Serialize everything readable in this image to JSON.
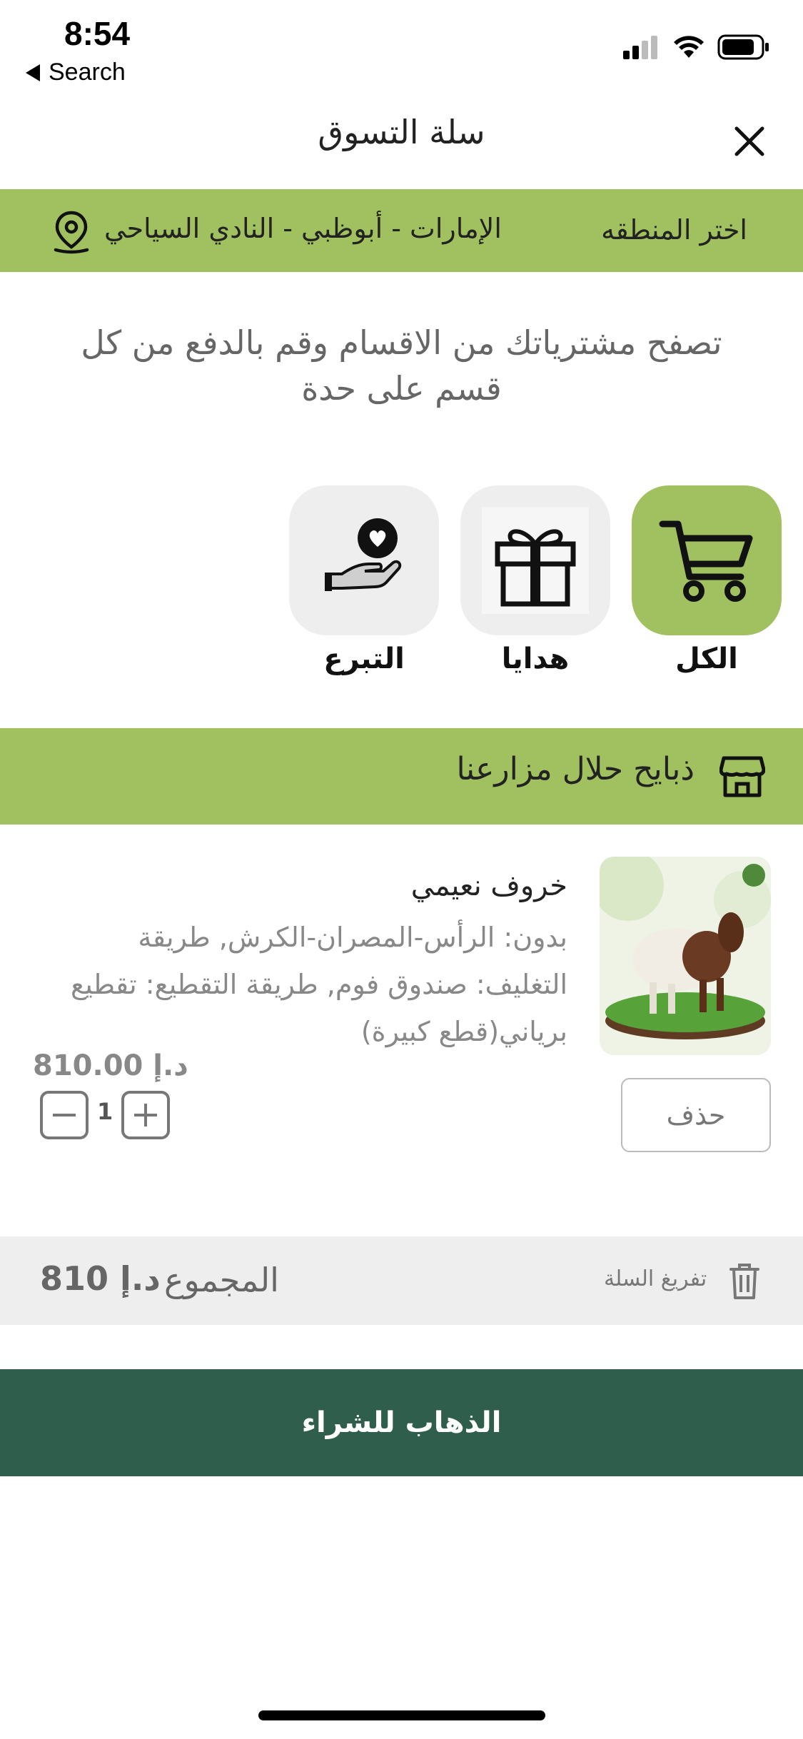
{
  "status_bar": {
    "time": "8:54",
    "back_label": "Search"
  },
  "header": {
    "title": "سلة التسوق",
    "close_icon": "close-icon"
  },
  "location": {
    "select_label": "اختر المنطقه",
    "value": "الإمارات - أبوظبي - النادي السياحي",
    "icon": "location-pin-icon"
  },
  "intro_text": "تصفح مشترياتك من الاقسام وقم بالدفع من كل قسم على حدة",
  "categories": [
    {
      "label": "الكل",
      "icon": "cart-icon",
      "active": true
    },
    {
      "label": "هدايا",
      "icon": "gift-icon",
      "active": false
    },
    {
      "label": "التبرع",
      "icon": "donation-icon",
      "active": false
    }
  ],
  "section": {
    "title": "ذبايح حلال مزارعنا",
    "icon": "store-icon"
  },
  "product": {
    "name": "خروف نعيمي",
    "description": "بدون: الرأس-المصران-الكرش, طريقة التغليف: صندوق فوم, طريقة التقطيع: تقطيع برياني(قطع كبيرة)",
    "price": "810.00 د.إ",
    "quantity": "1",
    "delete_label": "حذف"
  },
  "summary": {
    "clear_label": "تفريغ السلة",
    "total_label": "المجموع",
    "total_amount": "810 د.إ"
  },
  "checkout_label": "الذهاب للشراء",
  "colors": {
    "accent_green": "#a1c160",
    "checkout_green": "#2f5e4c",
    "muted_gray": "#eeeeee"
  }
}
